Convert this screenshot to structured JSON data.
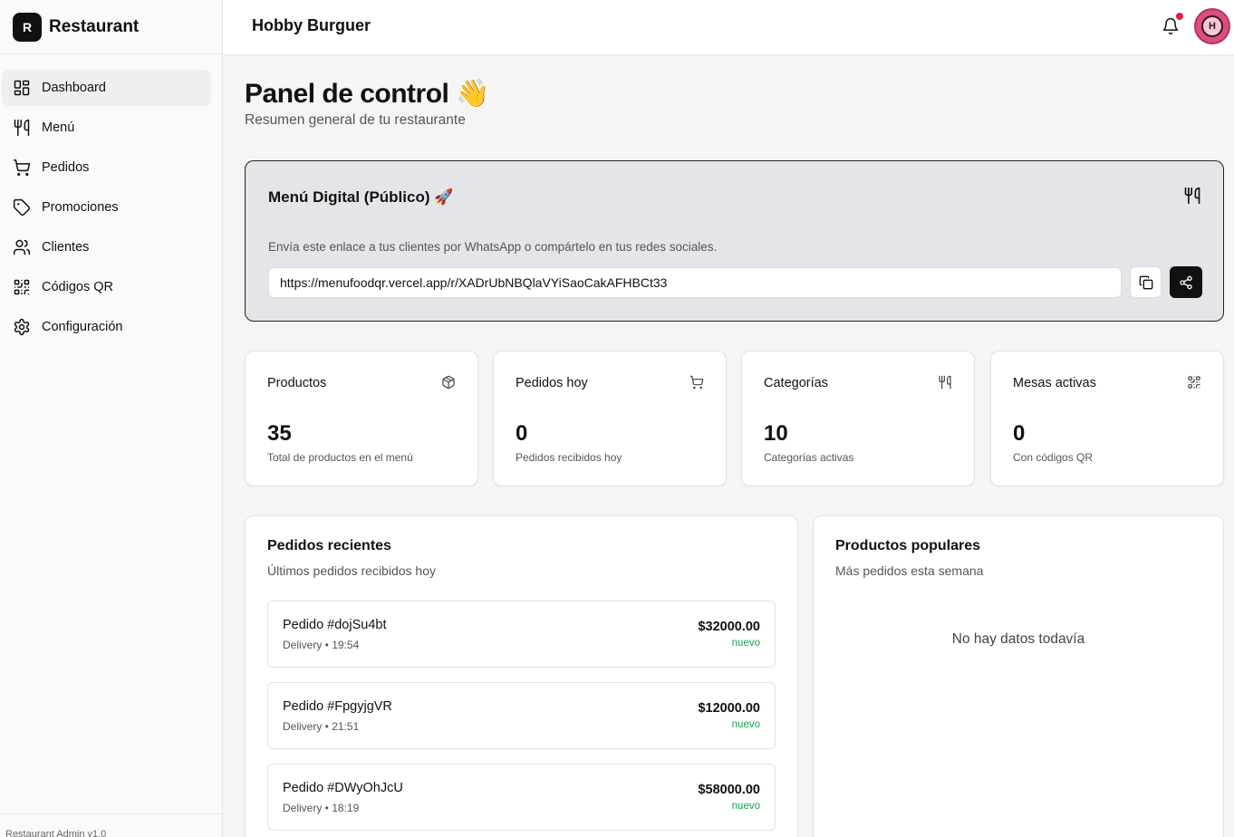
{
  "sidebar": {
    "brand_logo": "R",
    "brand_name": "Restaurant",
    "items": [
      {
        "label": "Dashboard",
        "icon": "dashboard-icon",
        "active": true
      },
      {
        "label": "Menú",
        "icon": "utensils-icon"
      },
      {
        "label": "Pedidos",
        "icon": "cart-icon"
      },
      {
        "label": "Promociones",
        "icon": "tag-icon"
      },
      {
        "label": "Clientes",
        "icon": "users-icon"
      },
      {
        "label": "Códigos QR",
        "icon": "qr-icon"
      },
      {
        "label": "Configuración",
        "icon": "gear-icon"
      }
    ],
    "version": "Restaurant Admin v1.0"
  },
  "topbar": {
    "title": "Hobby Burguer",
    "avatar_letter": "H"
  },
  "page": {
    "title": "Panel de control 👋",
    "subtitle": "Resumen general de tu restaurante"
  },
  "digital_menu": {
    "title": "Menú Digital (Público) 🚀",
    "description": "Envía este enlace a tus clientes por WhatsApp o compártelo en tus redes sociales.",
    "url": "https://menufoodqr.vercel.app/r/XADrUbNBQlaVYiSaoCakAFHBCt33"
  },
  "stats": [
    {
      "label": "Productos",
      "value": "35",
      "desc": "Total de productos en el menú",
      "icon": "package-icon"
    },
    {
      "label": "Pedidos hoy",
      "value": "0",
      "desc": "Pedidos recibidos hoy",
      "icon": "cart-icon"
    },
    {
      "label": "Categorías",
      "value": "10",
      "desc": "Categorías activas",
      "icon": "utensils-icon"
    },
    {
      "label": "Mesas activas",
      "value": "0",
      "desc": "Con códigos QR",
      "icon": "qr-icon"
    }
  ],
  "recent_orders": {
    "title": "Pedidos recientes",
    "subtitle": "Últimos pedidos recibidos hoy",
    "orders": [
      {
        "id": "Pedido #dojSu4bt",
        "meta": "Delivery • 19:54",
        "total": "$32000.00",
        "status": "nuevo"
      },
      {
        "id": "Pedido #FpgyjgVR",
        "meta": "Delivery • 21:51",
        "total": "$12000.00",
        "status": "nuevo"
      },
      {
        "id": "Pedido #DWyOhJcU",
        "meta": "Delivery • 18:19",
        "total": "$58000.00",
        "status": "nuevo"
      }
    ]
  },
  "popular_products": {
    "title": "Productos populares",
    "subtitle": "Más pedidos esta semana",
    "empty": "No hay datos todavía"
  },
  "colors": {
    "accent": "#111111",
    "status_new": "#16a34a",
    "notification_dot": "#e11d48"
  }
}
